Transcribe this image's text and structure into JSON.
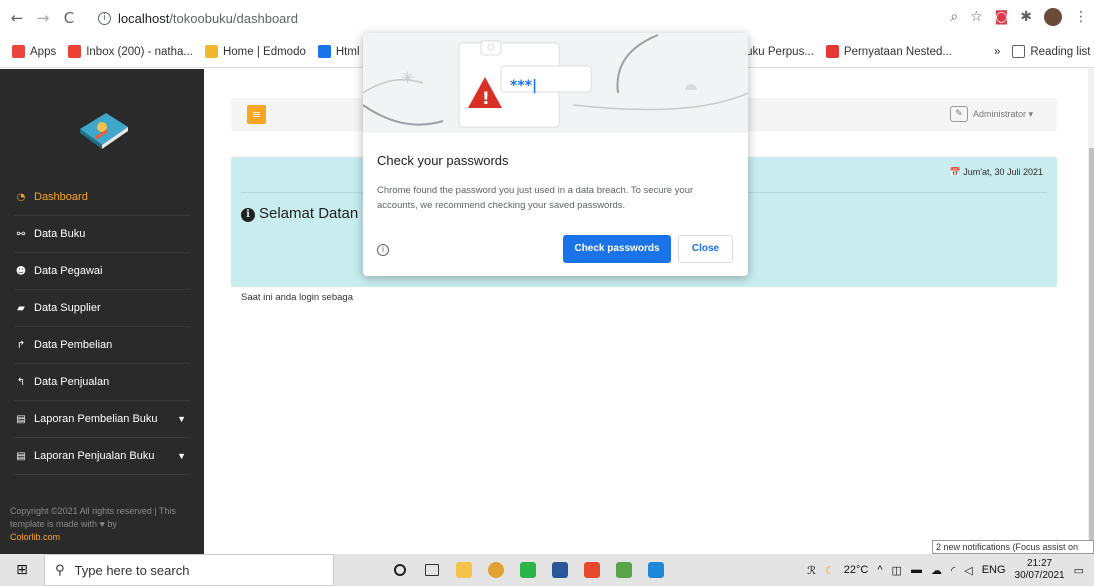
{
  "browser": {
    "url_host": "localhost",
    "url_path": "/tokoobuku/dashboard",
    "bookmarks": [
      {
        "label": "Apps",
        "color": "#e8453c"
      },
      {
        "label": "Inbox (200) - natha...",
        "color": "#ea4335"
      },
      {
        "label": "Home | Edmodo",
        "color": "#f1b82d"
      },
      {
        "label": "Html J",
        "color": "#1a73e8"
      },
      {
        "label": "Buku Perpus...",
        "color": "#5f6368"
      },
      {
        "label": "Pernyataan Nested...",
        "color": "#e53935"
      }
    ],
    "bookmarks_more": "»",
    "reading_list": "Reading list"
  },
  "sidebar": {
    "items": [
      {
        "label": "Dashboard",
        "icon": "tachometer-icon",
        "glyph": "◔",
        "active": true
      },
      {
        "label": "Data Buku",
        "icon": "share-icon",
        "glyph": "⚯"
      },
      {
        "label": "Data Pegawai",
        "icon": "users-icon",
        "glyph": "☻"
      },
      {
        "label": "Data Supplier",
        "icon": "truck-icon",
        "glyph": "▰"
      },
      {
        "label": "Data Pembelian",
        "icon": "share-arrow-icon",
        "glyph": "↱"
      },
      {
        "label": "Data Penjualan",
        "icon": "reply-icon",
        "glyph": "↰"
      },
      {
        "label": "Laporan Pembelian Buku",
        "icon": "file-icon",
        "glyph": "▤",
        "caret": true
      },
      {
        "label": "Laporan Penjualan Buku",
        "icon": "file-icon",
        "glyph": "▤",
        "caret": true
      }
    ],
    "copyright_line": "Copyright ©2021 All rights reserved | This template is made with ♥ by",
    "copyright_link": "Colorlib.com"
  },
  "topbar": {
    "menu_icon": "≡",
    "admin": "Administrator ▾"
  },
  "welcome": {
    "date": "📅 Jum'at, 30 Juli 2021",
    "title": "Selamat Datan",
    "text": "Saat ini anda login sebaga"
  },
  "popup": {
    "title": "Check your passwords",
    "body": "Chrome found the password you just used in a data breach. To secure your accounts, we recommend checking your saved passwords.",
    "check_button": "Check passwords",
    "close_button": "Close",
    "stars": "***|"
  },
  "notification": "2 new notifications (Focus assist on",
  "taskbar": {
    "search_placeholder": "Type here to search",
    "temperature": "22°C",
    "lang": "ENG",
    "time": "21:27",
    "date": "30/07/2021"
  }
}
